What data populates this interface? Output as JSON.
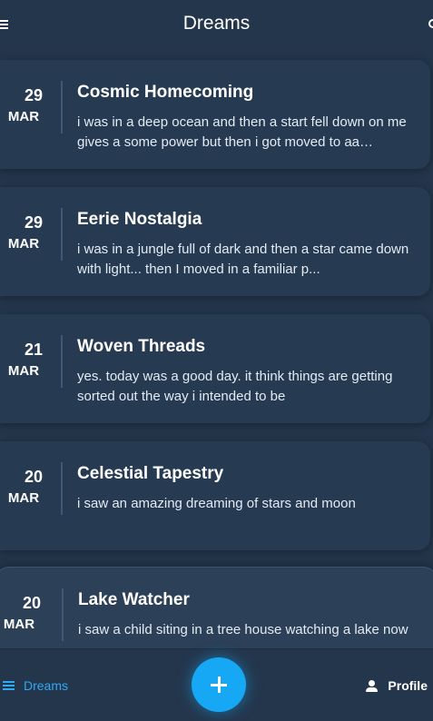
{
  "header": {
    "title": "Dreams"
  },
  "dreams": [
    {
      "day": "29",
      "month": "MAR",
      "title": "Cosmic Homecoming",
      "excerpt": "i was in a deep ocean and then a start fell down on me gives a some power but then i got moved to aa…"
    },
    {
      "day": "29",
      "month": "MAR",
      "title": "Eerie Nostalgia",
      "excerpt": "i was in a jungle full of dark and then a star came down with light...  then I moved in a familiar p..."
    },
    {
      "day": "21",
      "month": "MAR",
      "title": "Woven Threads",
      "excerpt": "yes. today was a good day. it think things are getting sorted out the way i intended to be"
    },
    {
      "day": "20",
      "month": "MAR",
      "title": "Celestial Tapestry",
      "excerpt": "i saw an amazing dreaming of stars and moon"
    },
    {
      "day": "20",
      "month": "MAR",
      "title": "Lake Watcher",
      "excerpt": "i saw a child siting in a tree house watching a lake now"
    }
  ],
  "bottom_nav": {
    "dreams_label": "Dreams",
    "profile_label": "Profile"
  },
  "colors": {
    "background": "#24364c",
    "card": "#263a52",
    "accent": "#16a8f4",
    "active_nav": "#2ea9f2"
  },
  "icons": {
    "menu": "menu-icon",
    "header_right": "header-right-icon",
    "dreams_nav": "list-icon",
    "profile_nav": "person-icon",
    "add": "plus-icon"
  }
}
